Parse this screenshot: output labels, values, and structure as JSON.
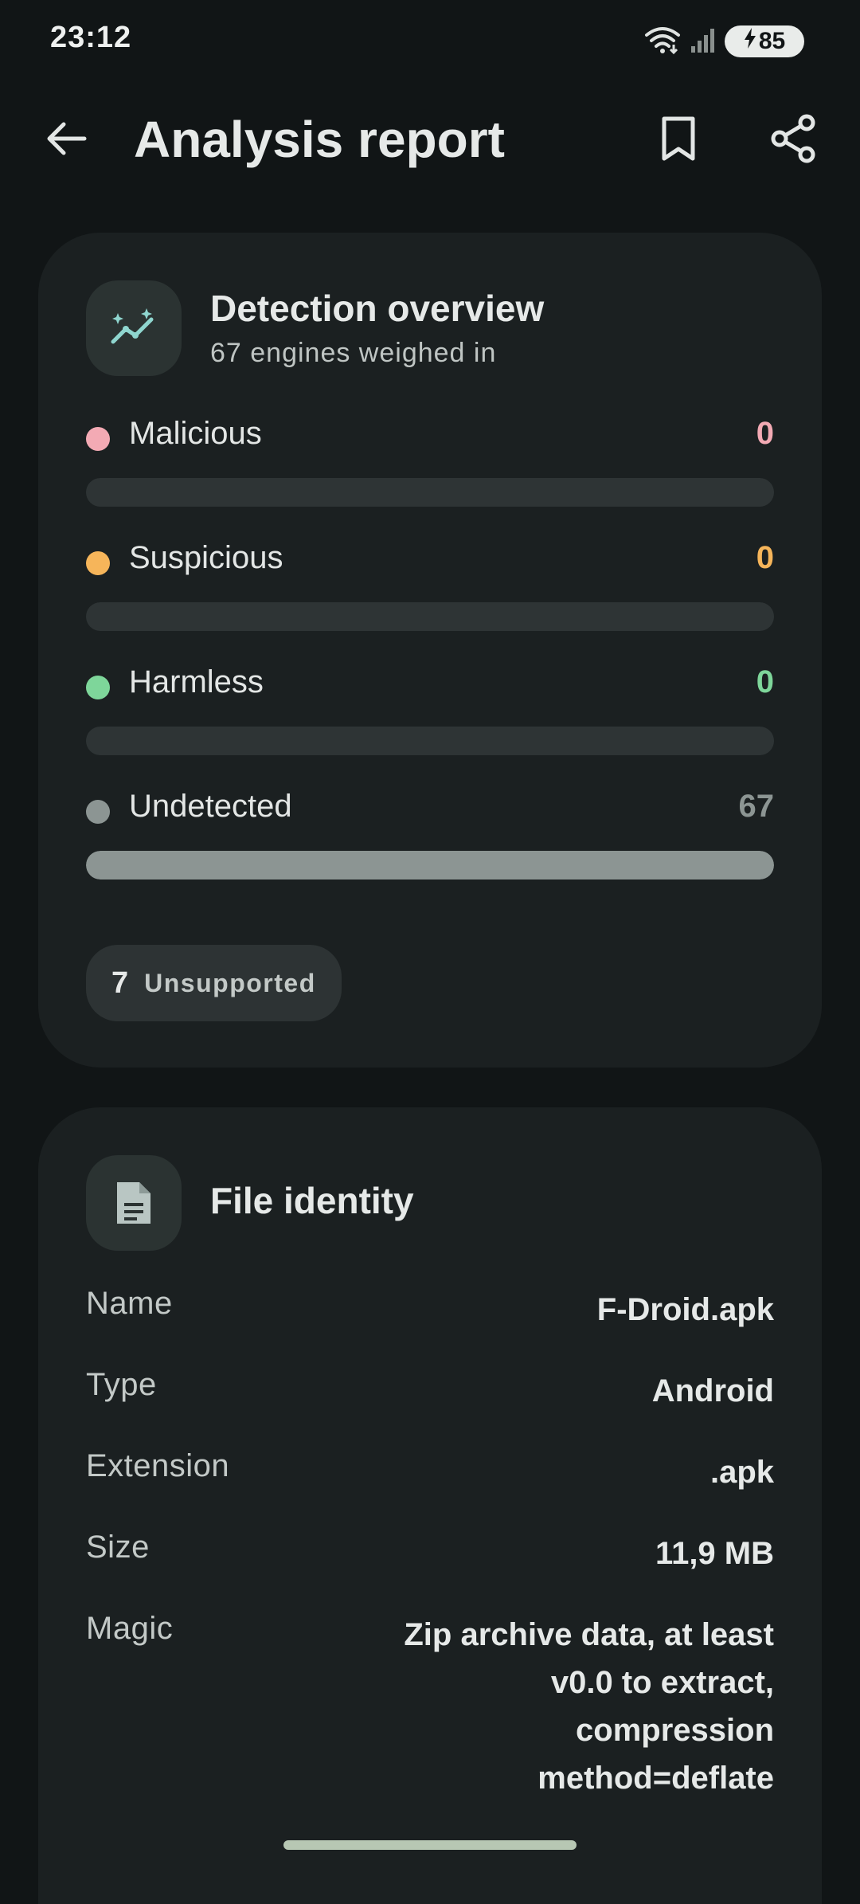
{
  "status_bar": {
    "time": "23:12",
    "battery": "85"
  },
  "header": {
    "title": "Analysis report",
    "back_icon": "arrow-left-icon",
    "bookmark_icon": "bookmark-icon",
    "share_icon": "share-icon"
  },
  "detection": {
    "title": "Detection overview",
    "subtitle": "67 engines weighed in",
    "icon": "sparkle-trend-icon",
    "stats": [
      {
        "label": "Malicious",
        "value": "0",
        "fraction": 0,
        "color": "#f3aab4"
      },
      {
        "label": "Suspicious",
        "value": "0",
        "fraction": 0,
        "color": "#f6b55a"
      },
      {
        "label": "Harmless",
        "value": "0",
        "fraction": 0,
        "color": "#7ed69a"
      },
      {
        "label": "Undetected",
        "value": "67",
        "fraction": 1,
        "color": "#8c9593"
      }
    ],
    "unsupported_count": "7",
    "unsupported_label": "Unsupported"
  },
  "file_identity": {
    "title": "File identity",
    "icon": "document-icon",
    "rows": [
      {
        "key": "Name",
        "value": "F-Droid.apk"
      },
      {
        "key": "Type",
        "value": "Android"
      },
      {
        "key": "Extension",
        "value": ".apk"
      },
      {
        "key": "Size",
        "value": "11,9 MB"
      },
      {
        "key": "Magic",
        "value": "Zip archive data, at least v0.0 to extract, compression method=deflate"
      }
    ]
  }
}
